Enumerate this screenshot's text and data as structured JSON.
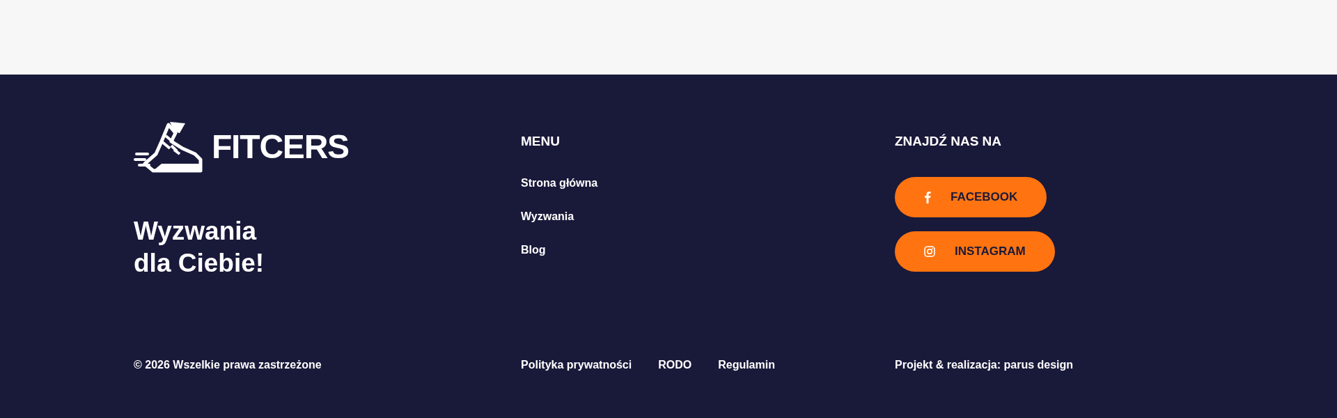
{
  "brand": {
    "logo_text": "FITCERS",
    "tagline_lines": [
      "Wyzwania",
      "dla Ciebie!"
    ]
  },
  "menu": {
    "title": "MENU",
    "items": [
      "Strona główna",
      "Wyzwania",
      "Blog"
    ]
  },
  "social": {
    "title": "ZNAJDŹ NAS NA",
    "buttons": [
      {
        "kind": "facebook",
        "label": "FACEBOOK"
      },
      {
        "kind": "instagram",
        "label": "INSTAGRAM"
      }
    ]
  },
  "bottom": {
    "copyright": "© 2026 Wszelkie prawa zastrzeżone",
    "links": [
      "Polityka prywatności",
      "RODO",
      "Regulamin"
    ],
    "credits": "Projekt & realizacja: parus design"
  }
}
